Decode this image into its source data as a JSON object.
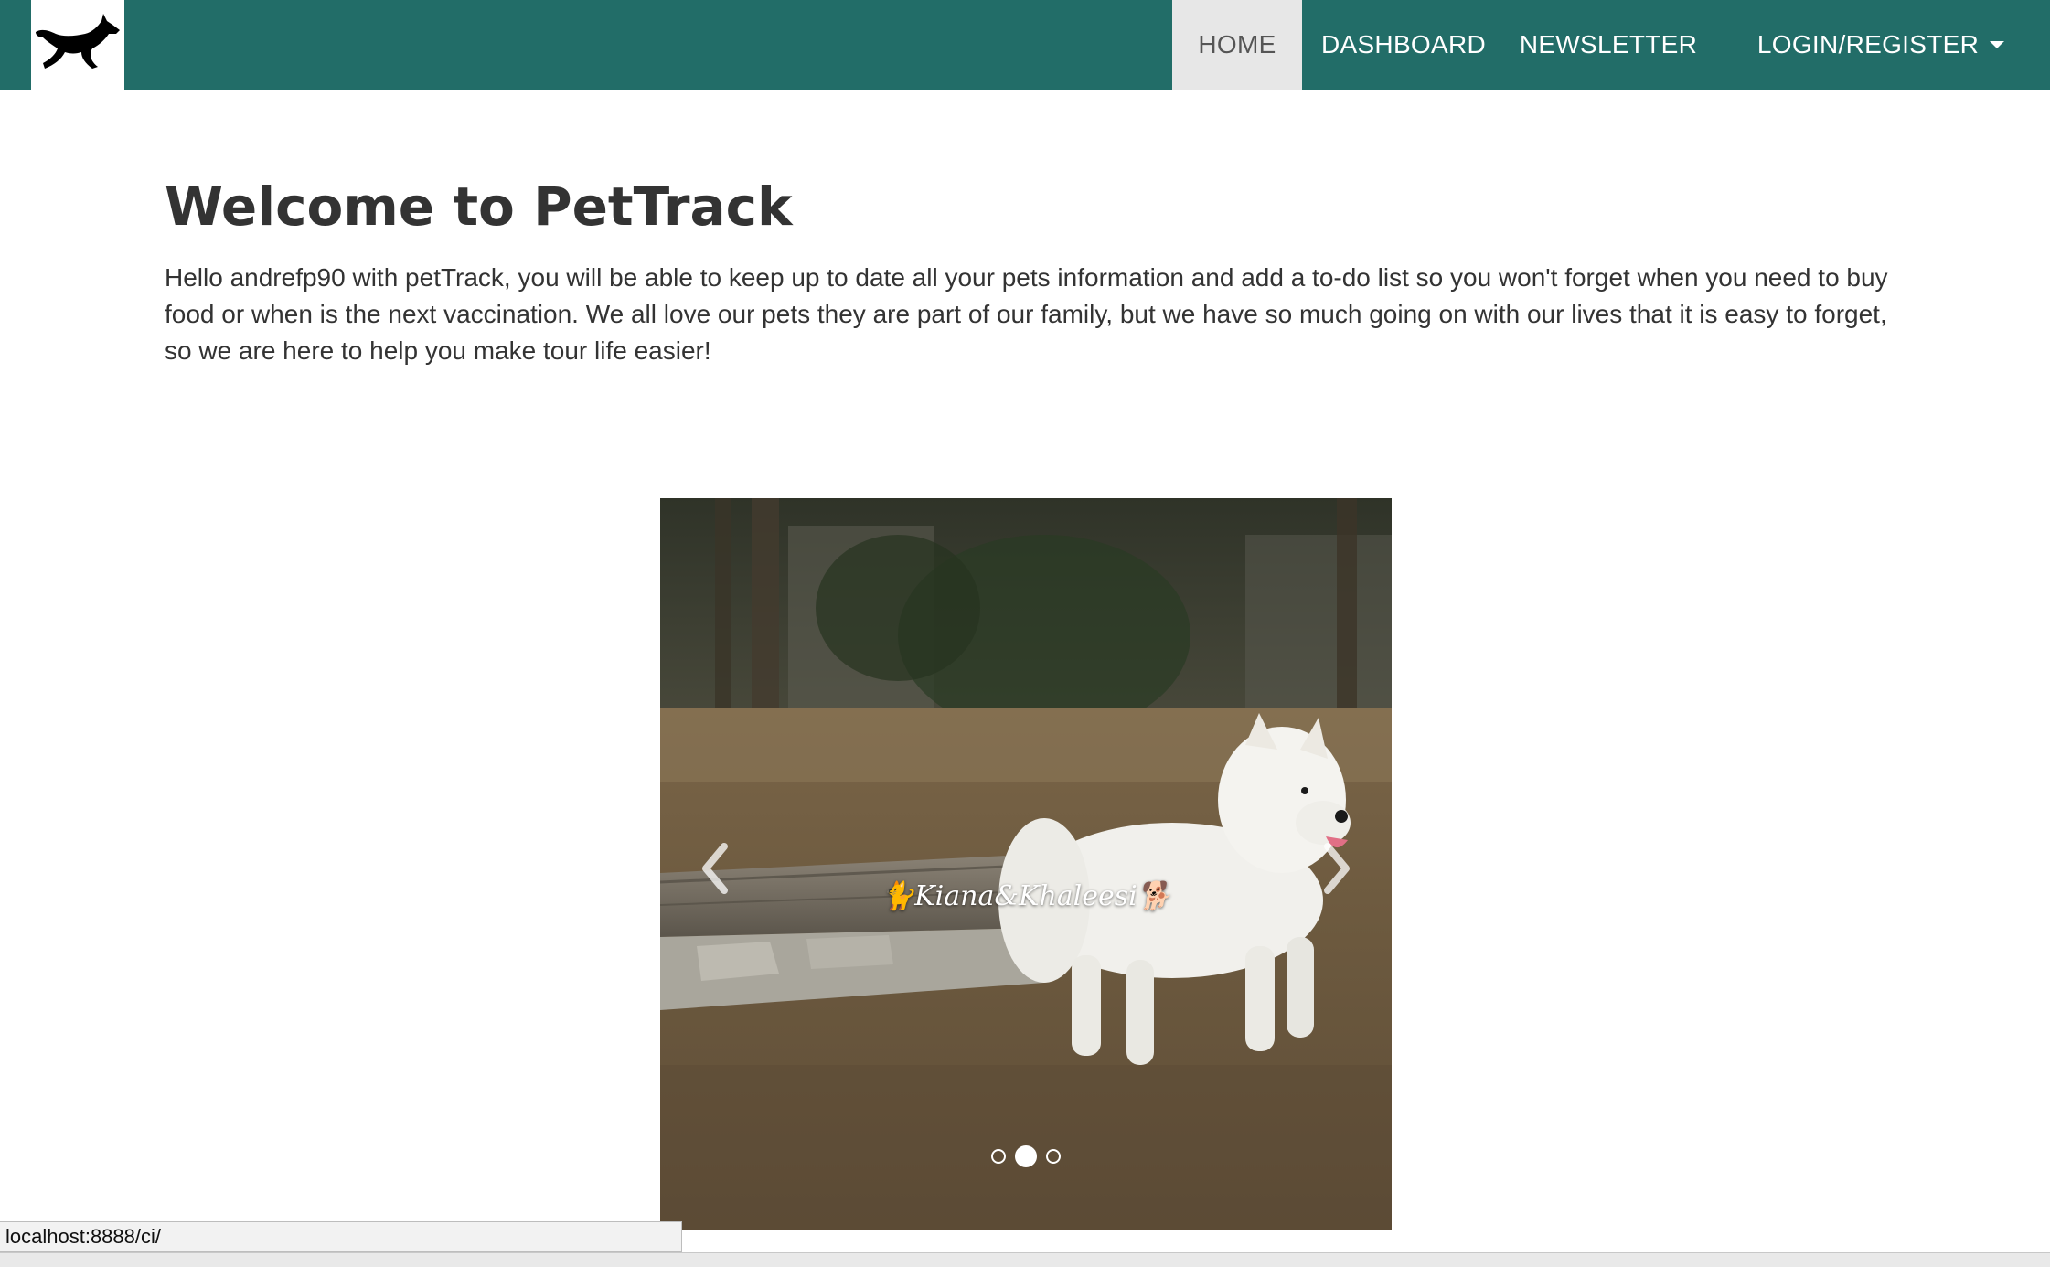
{
  "brand": {
    "logo_icon": "running-dog-icon"
  },
  "nav": {
    "items": [
      {
        "label": "HOME"
      },
      {
        "label": "DASHBOARD"
      },
      {
        "label": "NEWSLETTER"
      },
      {
        "label": "LOGIN/REGISTER"
      }
    ],
    "active": "HOME"
  },
  "main": {
    "title": "Welcome to PetTrack",
    "intro": "Hello andrefp90 with petTrack, you will be able to keep up to date all your pets information and add a to-do list so you won't forget when you need to buy food or when is the next vaccination. We all love our pets they are part of our family, but we have so much going on with our lives that it is easy to forget, so we are here to help you make tour life easier!"
  },
  "carousel": {
    "caption": "Kiana&Khaleesi",
    "active_index": 1,
    "slide_count": 3,
    "prev_icon": "chevron-left-icon",
    "next_icon": "chevron-right-icon"
  },
  "status": {
    "url": "localhost:8888/ci/"
  },
  "colors": {
    "navbar": "#226d68",
    "active_tab": "#e7e7e7",
    "text": "#333333"
  }
}
